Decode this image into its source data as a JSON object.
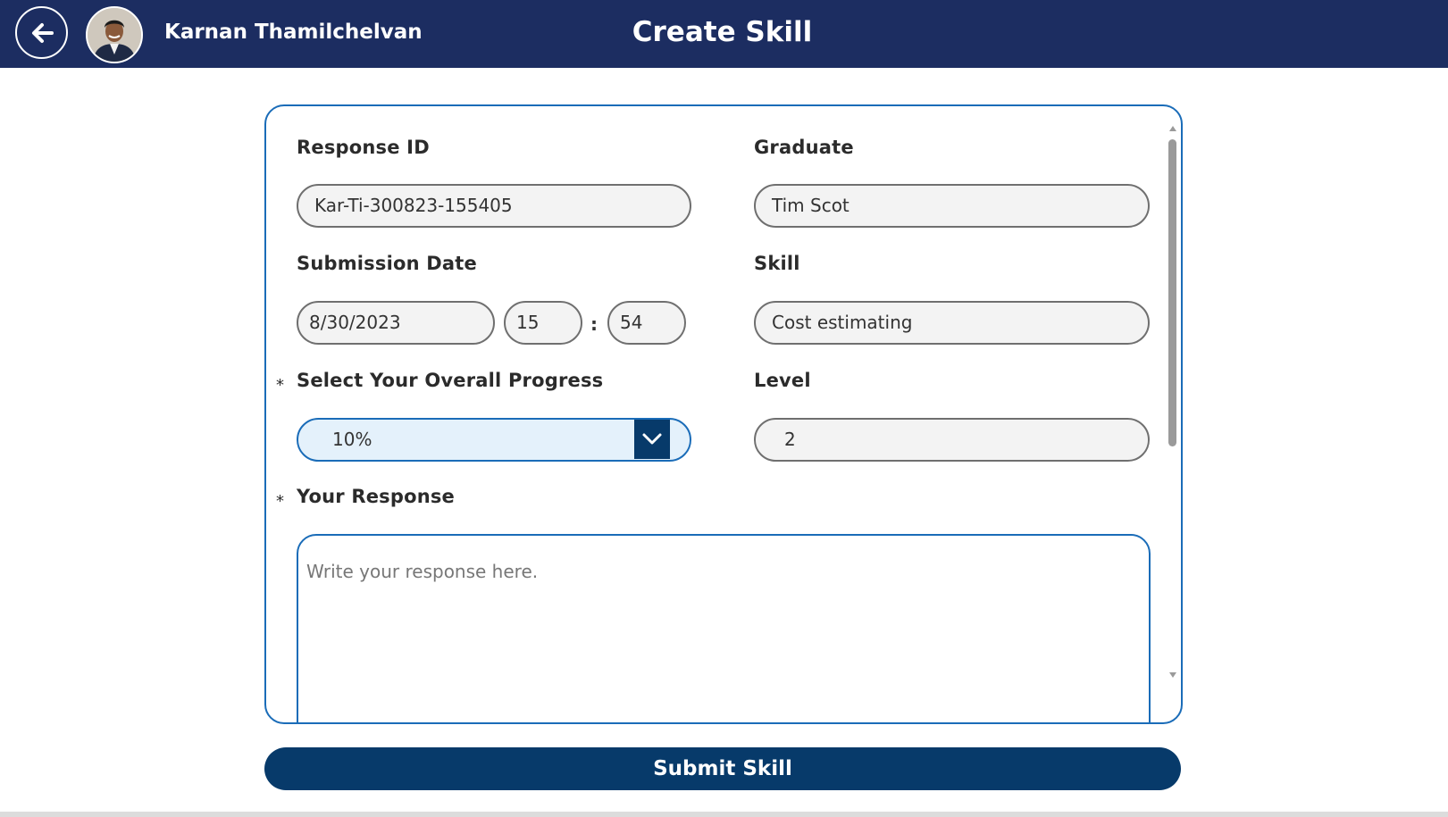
{
  "header": {
    "user_name": "Karnan Thamilchelvan",
    "title": "Create Skill",
    "back_icon": "arrow-left-icon",
    "avatar": "user-avatar-photo"
  },
  "form": {
    "response_id": {
      "label": "Response ID",
      "value": "Kar-Ti-300823-155405"
    },
    "graduate": {
      "label": "Graduate",
      "value": "Tim Scot"
    },
    "submission_date": {
      "label": "Submission Date",
      "date": "8/30/2023",
      "hour": "15",
      "separator": ":",
      "minute": "54"
    },
    "skill": {
      "label": "Skill",
      "value": "Cost estimating"
    },
    "progress": {
      "required_mark": "*",
      "label": "Select Your Overall Progress",
      "selected": "10%",
      "icon": "chevron-down-icon"
    },
    "level": {
      "label": "Level",
      "value": "2"
    },
    "response": {
      "required_mark": "*",
      "label": "Your Response",
      "placeholder": "Write your response here."
    }
  },
  "submit": {
    "label": "Submit Skill"
  },
  "colors": {
    "header_bg": "#1c2d61",
    "accent": "#1a6cb8",
    "button_bg": "#073a6a",
    "dropdown_bg": "#e4f1fb",
    "field_bg": "#f3f3f3"
  }
}
